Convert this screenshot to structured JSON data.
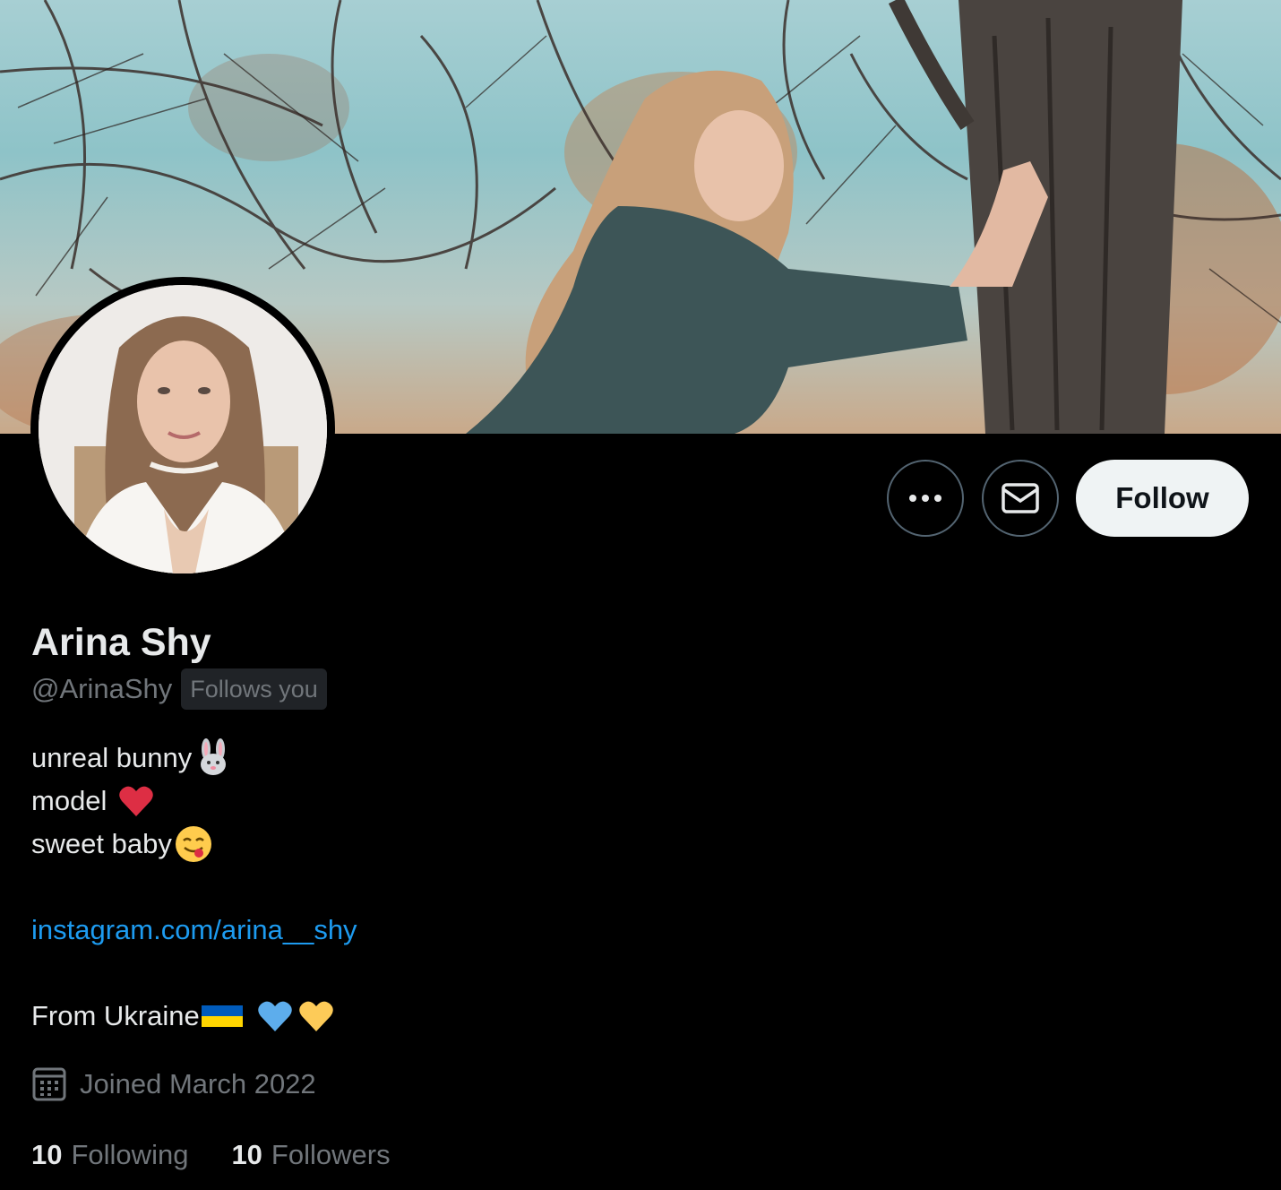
{
  "profile": {
    "name": "Arina Shy",
    "handle": "@ArinaShy",
    "follows_you_badge": "Follows you",
    "joined": "Joined March 2022"
  },
  "actions": {
    "more_icon": "more-horizontal-icon",
    "message_icon": "envelope-icon",
    "follow_label": "Follow"
  },
  "bio": {
    "line1": "unreal bunny",
    "line1_emoji": "rabbit-face",
    "line2": "model ",
    "line2_emoji": "red-heart",
    "line3": "sweet baby",
    "line3_emoji": "face-savoring-food",
    "link": "instagram.com/arina__shy",
    "line5": "From Ukraine",
    "line5_emoji": [
      "flag-ukraine",
      "blue-heart",
      "yellow-heart"
    ]
  },
  "stats": {
    "following_count": "10",
    "following_label": "Following",
    "followers_count": "10",
    "followers_label": "Followers"
  },
  "colors": {
    "background": "#000000",
    "text_primary": "#e7e9ea",
    "text_secondary": "#71767b",
    "link": "#1d9bf0",
    "follow_button_bg": "#eff3f4",
    "button_border": "#536471"
  }
}
